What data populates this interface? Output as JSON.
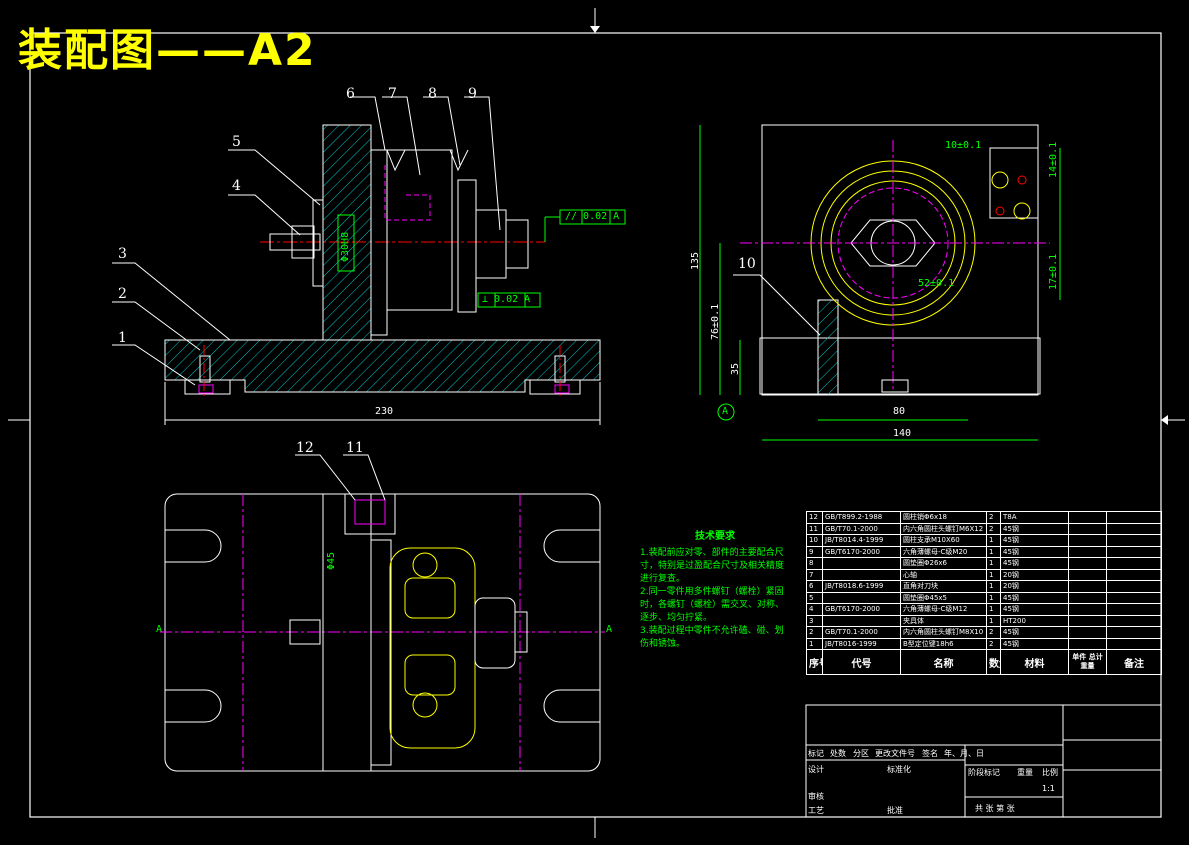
{
  "drawing": {
    "title": "装配图——A2"
  },
  "callouts": {
    "front": [
      "6",
      "7",
      "8",
      "9",
      "5",
      "4",
      "3",
      "2",
      "1"
    ],
    "side": [
      "10"
    ],
    "top": [
      "12",
      "11"
    ]
  },
  "dimensions": {
    "overall_length": "230",
    "bore_diameter": "Φ30H8",
    "parallelism": "// 0.02 A",
    "flatness": "⊥ 0.02 A",
    "side_width_inner": "80",
    "side_width_outer": "140",
    "side_height": "135",
    "side_height_76": "76±0.1",
    "side_h35": "35",
    "dim_10": "10±0.1",
    "dim_52": "52±0.1",
    "dim_14": "14±0.1",
    "dim_17": "17±0.1",
    "datum_a": "A",
    "top_dim": "Φ45",
    "section_a_left": "A",
    "section_a_right": "A"
  },
  "tech_requirements": {
    "heading": "技术要求",
    "items": [
      "1.装配前应对零、部件的主要配合尺寸，特别是过盈配合尺寸及相关精度进行复查。",
      "2.同一零件用多件螺钉（螺栓）紧固时，各螺钉（螺栓）需交叉、对称、逐步、均匀拧紧。",
      "3.装配过程中零件不允许磕、碰、划伤和锈蚀。"
    ]
  },
  "bom": {
    "rows": [
      [
        "12",
        "GB/T899.2-1988",
        "圆柱销Φ6x18",
        "2",
        "T8A",
        ""
      ],
      [
        "11",
        "GB/T70.1-2000",
        "内六角圆柱头螺钉M6X12",
        "2",
        "45钢",
        ""
      ],
      [
        "10",
        "JB/T8014.4-1999",
        "圆柱支承M10X60",
        "1",
        "45钢",
        ""
      ],
      [
        "9",
        "GB/T6170-2000",
        "六角薄螺母-C级M20",
        "1",
        "45钢",
        ""
      ],
      [
        "8",
        "",
        "圆垫圈Φ26x6",
        "1",
        "45钢",
        ""
      ],
      [
        "7",
        "",
        "心轴",
        "1",
        "20钢",
        ""
      ],
      [
        "6",
        "JB/T8018.6-1999",
        "直角对刀块",
        "1",
        "20钢",
        ""
      ],
      [
        "5",
        "",
        "圆垫圈Φ45x5",
        "1",
        "45钢",
        ""
      ],
      [
        "4",
        "GB/T6170-2000",
        "六角薄螺母-C级M12",
        "1",
        "45钢",
        ""
      ],
      [
        "3",
        "",
        "夹具体",
        "1",
        "HT200",
        ""
      ],
      [
        "2",
        "GB/T70.1-2000",
        "内六角圆柱头螺钉M8X10",
        "2",
        "45钢",
        ""
      ],
      [
        "1",
        "JB/T8016-1999",
        "B型定位键18h6",
        "2",
        "45钢",
        ""
      ]
    ],
    "header": {
      "no": "序号",
      "code": "代号",
      "name": "名称",
      "qty": "数量",
      "material": "材料",
      "single": "单件",
      "total": "总计",
      "weight": "重量",
      "remark": "备注"
    }
  },
  "title_block": {
    "mark": "标记",
    "count": "处数",
    "zone": "分区",
    "change_doc": "更改文件号",
    "sign": "签名",
    "date": "年、月、日",
    "design": "设计",
    "standard": "标准化",
    "stage": "阶段标记",
    "weight": "重量",
    "scale": "比例",
    "scale_value": "1:1",
    "review": "审核",
    "process": "工艺",
    "approve": "批准",
    "sheets": "共  张  第  张"
  },
  "colors": {
    "background": "#000000",
    "line": "#ffffff",
    "hatch": "#00c8c8",
    "center": "#ff00ff",
    "dimension_green": "#00ff00",
    "yellow": "#ffff00",
    "red": "#ff0000"
  }
}
